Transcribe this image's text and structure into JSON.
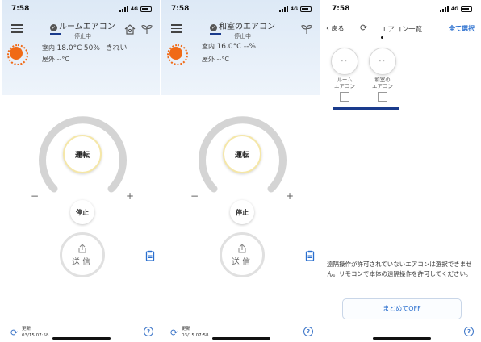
{
  "panels": [
    {
      "time": "7:58",
      "network": "4G",
      "title": "ルームエアコン",
      "state": "停止中",
      "indoor_label": "室内",
      "indoor_temp": "18.0°C",
      "indoor_humidity": "50%",
      "air_quality": "きれい",
      "outdoor_label": "屋外",
      "outdoor_temp": "--°C",
      "run_label": "運転",
      "minus": "−",
      "plus": "+",
      "stop_label": "停止",
      "send_label": "送信",
      "updated_label": "更新",
      "updated_time": "03/15 07:58",
      "help": "?"
    },
    {
      "time": "7:58",
      "network": "4G",
      "title": "和室のエアコン",
      "state": "停止中",
      "indoor_label": "室内",
      "indoor_temp": "16.0°C",
      "indoor_humidity": "--%",
      "air_quality": "",
      "outdoor_label": "屋外",
      "outdoor_temp": "--°C",
      "run_label": "運転",
      "minus": "−",
      "plus": "+",
      "stop_label": "停止",
      "send_label": "送信",
      "updated_label": "更新",
      "updated_time": "03/15 07:58",
      "help": "?"
    }
  ],
  "list": {
    "time": "7:58",
    "network": "4G",
    "back": "戻る",
    "title": "エアコン一覧",
    "select_all": "全て選択",
    "units": [
      {
        "temp": "--",
        "name_line1": "ルーム",
        "name_line2": "エアコン"
      },
      {
        "temp": "--",
        "name_line1": "和室の",
        "name_line2": "エアコン"
      }
    ],
    "note": "遠隔操作が許可されていないエアコンは選択できません。リモコンで本体の遠隔操作を許可してください。",
    "all_off": "まとめてOFF",
    "help": "?"
  },
  "colors": {
    "accent_blue": "#2a6fcf",
    "navy": "#1a3b8c",
    "sun_orange": "#f06a16",
    "header_bg": "#dde9f6"
  }
}
